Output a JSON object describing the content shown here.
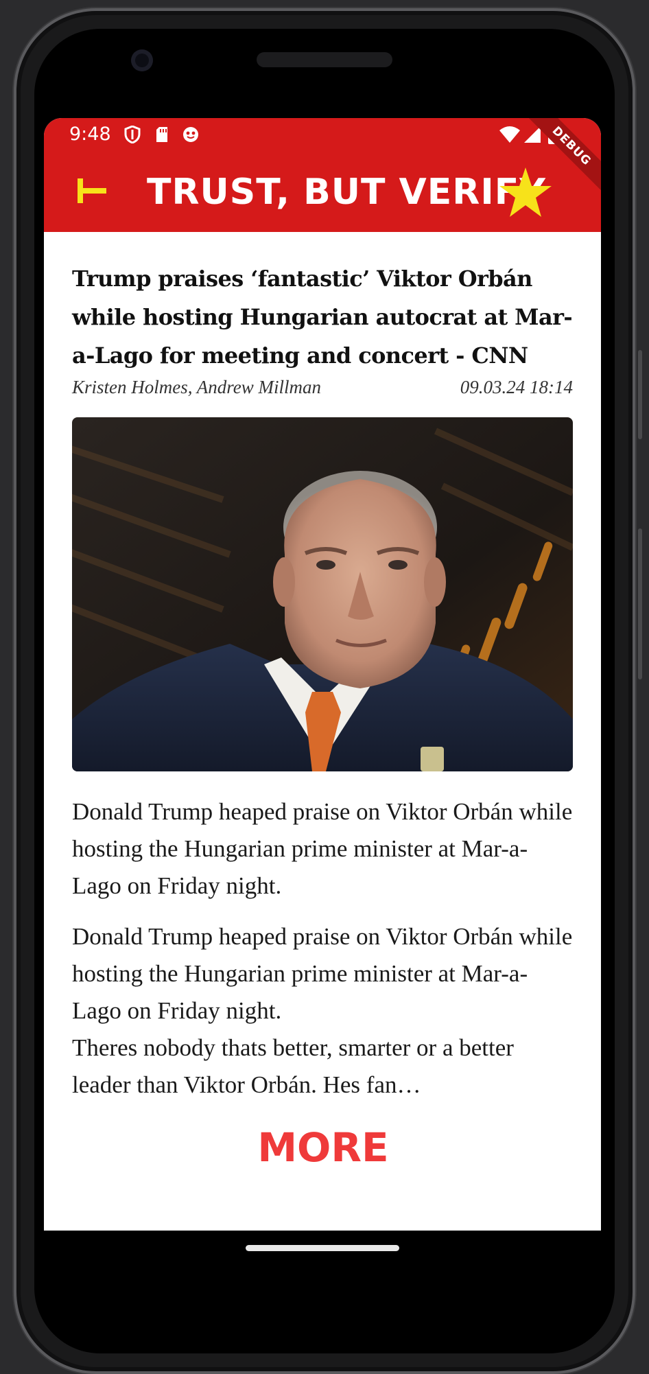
{
  "status_bar": {
    "time": "9:48",
    "icons": [
      "shield-icon",
      "sd-card-icon",
      "app-notification-icon",
      "wifi-icon",
      "signal-icon",
      "battery-icon"
    ],
    "background_color": "#d51a1a"
  },
  "debug_banner": "DEBUG",
  "app_bar": {
    "title": "TRUST, BUT VERIFY",
    "back_icon": "back-arrow-icon",
    "favorite_icon": "star-icon",
    "accent_color": "#f7e21a"
  },
  "article": {
    "headline": "Trump praises ‘fantastic’ Viktor Orbán while hosting Hungarian autocrat at Mar-a-Lago for meeting and concert - CNN",
    "authors": "Kristen Holmes, Andrew Millman",
    "date": "09.03.24 18:14",
    "summary": "Donald Trump heaped praise on Viktor Orbán while hosting the Hungarian prime minister at Mar-a-Lago on Friday night.",
    "body_lines": [
      "Donald Trump heaped praise on Viktor Orbán while hosting the Hungarian prime minister at Mar-a-Lago on Friday night.",
      "Theres nobody thats better, smarter or a better leader than Viktor Orbán. Hes fan…"
    ]
  },
  "more_button": {
    "label": "MORE",
    "color": "#ef3a3a"
  }
}
